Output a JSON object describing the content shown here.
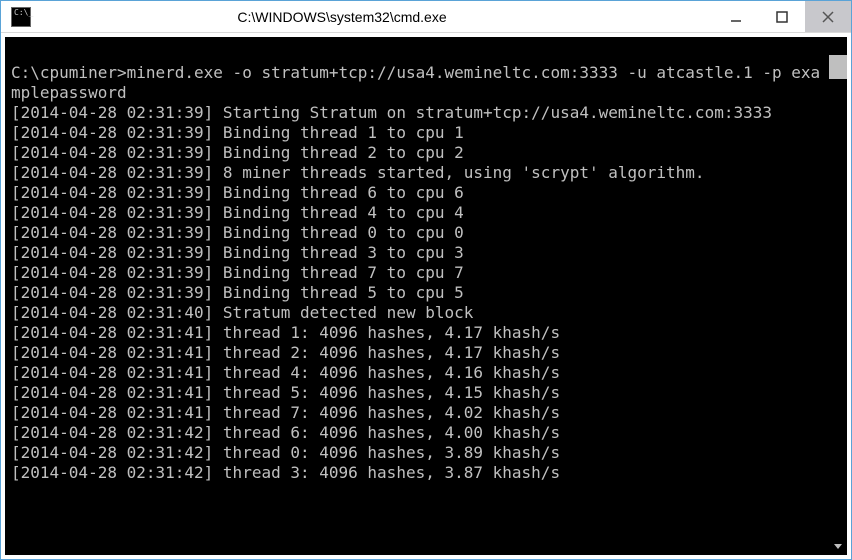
{
  "window": {
    "title": "C:\\WINDOWS\\system32\\cmd.exe"
  },
  "terminal": {
    "prompt": "C:\\cpuminer>",
    "command": "minerd.exe -o stratum+tcp://usa4.wemineltc.com:3333 -u atcastle.1 -p examplepassword",
    "lines": [
      "[2014-04-28 02:31:39] Starting Stratum on stratum+tcp://usa4.wemineltc.com:3333",
      "[2014-04-28 02:31:39] Binding thread 1 to cpu 1",
      "[2014-04-28 02:31:39] Binding thread 2 to cpu 2",
      "[2014-04-28 02:31:39] 8 miner threads started, using 'scrypt' algorithm.",
      "[2014-04-28 02:31:39] Binding thread 6 to cpu 6",
      "[2014-04-28 02:31:39] Binding thread 4 to cpu 4",
      "[2014-04-28 02:31:39] Binding thread 0 to cpu 0",
      "[2014-04-28 02:31:39] Binding thread 3 to cpu 3",
      "[2014-04-28 02:31:39] Binding thread 7 to cpu 7",
      "[2014-04-28 02:31:39] Binding thread 5 to cpu 5",
      "[2014-04-28 02:31:40] Stratum detected new block",
      "[2014-04-28 02:31:41] thread 1: 4096 hashes, 4.17 khash/s",
      "[2014-04-28 02:31:41] thread 2: 4096 hashes, 4.17 khash/s",
      "[2014-04-28 02:31:41] thread 4: 4096 hashes, 4.16 khash/s",
      "[2014-04-28 02:31:41] thread 5: 4096 hashes, 4.15 khash/s",
      "[2014-04-28 02:31:41] thread 7: 4096 hashes, 4.02 khash/s",
      "[2014-04-28 02:31:42] thread 6: 4096 hashes, 4.00 khash/s",
      "[2014-04-28 02:31:42] thread 0: 4096 hashes, 3.89 khash/s",
      "[2014-04-28 02:31:42] thread 3: 4096 hashes, 3.87 khash/s"
    ]
  }
}
